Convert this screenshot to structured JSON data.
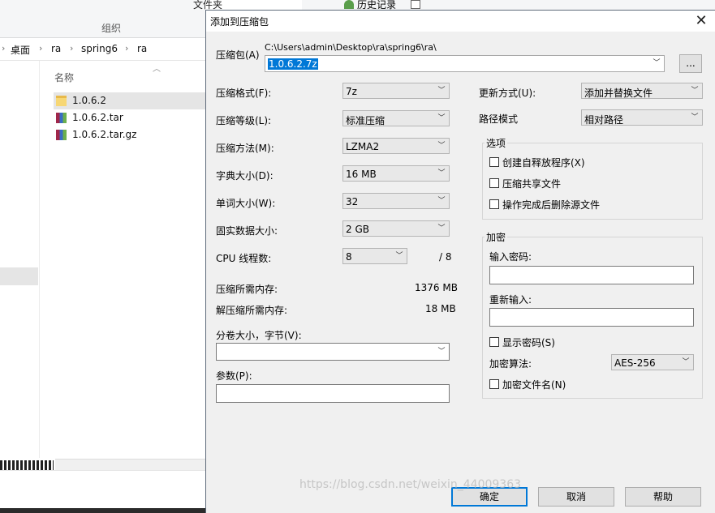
{
  "explorer": {
    "ribbon_partial": "文件夹",
    "ribbon_group": "组织",
    "history_label": "历史记录",
    "breadcrumbs": [
      "桌面",
      "ra",
      "spring6",
      "ra"
    ],
    "column_name": "名称",
    "files": [
      {
        "name": "1.0.6.2",
        "icon": "folder-icon",
        "selected": true
      },
      {
        "name": "1.0.6.2.tar",
        "icon": "archive-icon",
        "selected": false
      },
      {
        "name": "1.0.6.2.tar.gz",
        "icon": "archive-icon",
        "selected": false
      }
    ]
  },
  "dialog": {
    "title": "添加到压缩包",
    "close_glyph": "✕",
    "archive_label": "压缩包(A)",
    "archive_path": "C:\\Users\\admin\\Desktop\\ra\\spring6\\ra\\",
    "archive_name": "1.0.6.2.7z",
    "browse_label": "...",
    "left": {
      "format_label": "压缩格式(F):",
      "format_value": "7z",
      "level_label": "压缩等级(L):",
      "level_value": "标准压缩",
      "method_label": "压缩方法(M):",
      "method_value": "LZMA2",
      "dict_label": "字典大小(D):",
      "dict_value": "16 MB",
      "word_label": "单词大小(W):",
      "word_value": "32",
      "solid_label": "固实数据大小:",
      "solid_value": "2 GB",
      "threads_label": "CPU 线程数:",
      "threads_value": "8",
      "threads_max": "/ 8",
      "mem_comp_label": "压缩所需内存:",
      "mem_comp_value": "1376 MB",
      "mem_decomp_label": "解压缩所需内存:",
      "mem_decomp_value": "18 MB",
      "split_label": "分卷大小，字节(V):",
      "split_value": "",
      "params_label": "参数(P):",
      "params_value": ""
    },
    "right": {
      "update_label": "更新方式(U):",
      "update_value": "添加并替换文件",
      "path_label": "路径模式",
      "path_value": "相对路径",
      "options_title": "选项",
      "options": [
        "创建自释放程序(X)",
        "压缩共享文件",
        "操作完成后删除源文件"
      ],
      "encrypt_title": "加密",
      "password_label": "输入密码:",
      "reenter_label": "重新输入:",
      "show_password": "显示密码(S)",
      "algo_label": "加密算法:",
      "algo_value": "AES-256",
      "encrypt_names": "加密文件名(N)"
    },
    "buttons": {
      "ok": "确定",
      "cancel": "取消",
      "help": "帮助"
    }
  },
  "watermark": "https://blog.csdn.net/weixin_44009363",
  "colors": {
    "accent": "#0078d7",
    "dialog_bg": "#f0f0f0"
  }
}
